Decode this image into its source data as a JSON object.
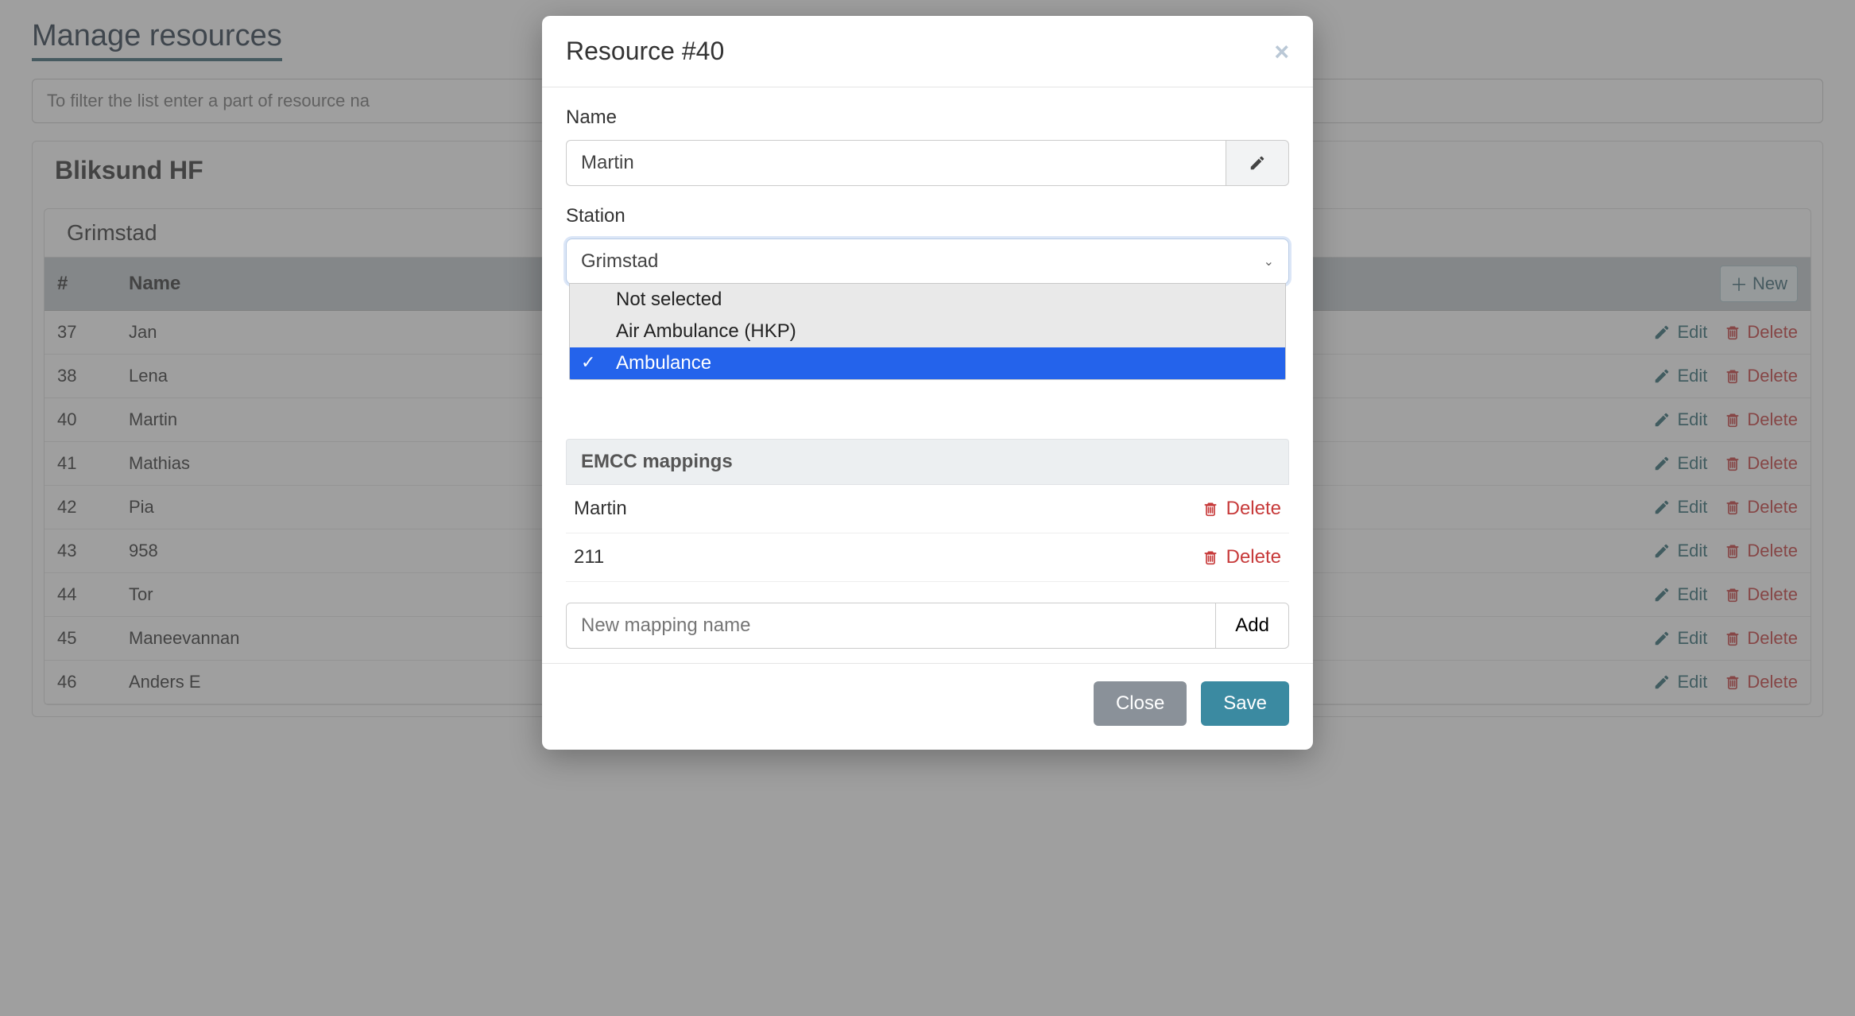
{
  "page": {
    "title": "Manage resources",
    "filter_placeholder": "To filter the list enter a part of resource na",
    "org": "Bliksund HF",
    "station": "Grimstad",
    "columns": {
      "id": "#",
      "name": "Name"
    },
    "new_label": "New",
    "edit_label": "Edit",
    "delete_label": "Delete",
    "rows": [
      {
        "id": "37",
        "name": "Jan"
      },
      {
        "id": "38",
        "name": "Lena"
      },
      {
        "id": "40",
        "name": "Martin"
      },
      {
        "id": "41",
        "name": "Mathias"
      },
      {
        "id": "42",
        "name": "Pia"
      },
      {
        "id": "43",
        "name": "958"
      },
      {
        "id": "44",
        "name": "Tor"
      },
      {
        "id": "45",
        "name": "Maneevannan"
      },
      {
        "id": "46",
        "name": "Anders E"
      }
    ]
  },
  "modal": {
    "title": "Resource #40",
    "name_label": "Name",
    "name_value": "Martin",
    "station_label": "Station",
    "station_value": "Grimstad",
    "station_options": [
      {
        "label": "Not selected",
        "selected": false
      },
      {
        "label": "Air Ambulance (HKP)",
        "selected": false
      },
      {
        "label": "Ambulance",
        "selected": true
      }
    ],
    "emcc_heading": "EMCC mappings",
    "mappings": [
      {
        "name": "Martin"
      },
      {
        "name": "211"
      }
    ],
    "new_mapping_placeholder": "New mapping name",
    "add_label": "Add",
    "delete_label": "Delete",
    "close_label": "Close",
    "save_label": "Save"
  },
  "colors": {
    "accent": "#3b8aa1",
    "danger": "#c73a3a",
    "dropdown_highlight": "#2463eb"
  }
}
